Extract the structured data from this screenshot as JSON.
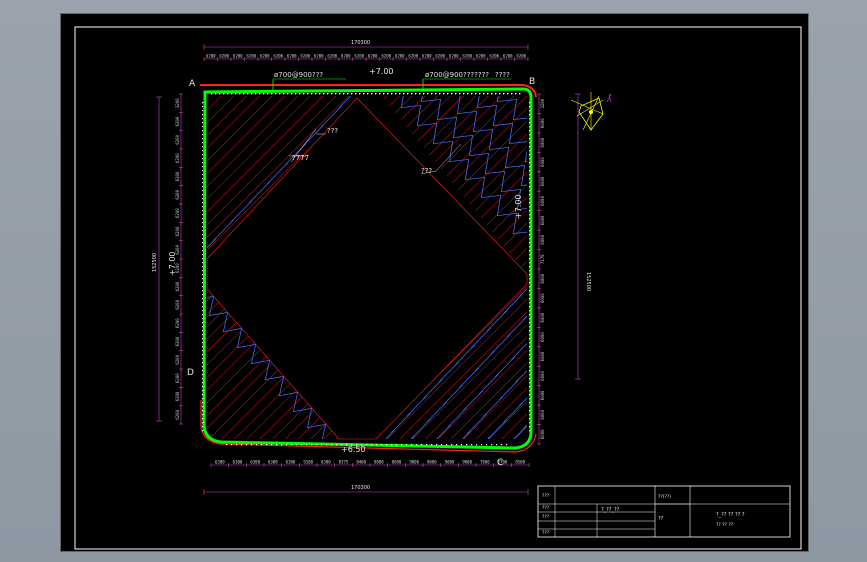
{
  "drawing": {
    "corner_labels": {
      "a": "A",
      "b": "B",
      "c": "C",
      "d": "D"
    },
    "overall_dims": {
      "top": "170300",
      "bottom": "170300",
      "left": "152500",
      "right": "152500"
    },
    "elevations": {
      "top": "+7.00",
      "left": "+7.00",
      "right": "+7.00",
      "bottom": "+6.50"
    },
    "top_callouts": [
      "ø700@900???",
      "ø700@900???????",
      "????"
    ],
    "leaders": [
      "???",
      "?777",
      "???"
    ],
    "top_segments": [
      "6200",
      "6200",
      "6200",
      "6200",
      "6200",
      "6200",
      "6200",
      "6200",
      "6200",
      "6200",
      "6200",
      "6200",
      "6200",
      "6200",
      "6200",
      "6200",
      "6200",
      "6200",
      "6200",
      "6200",
      "6200",
      "6200",
      "6200",
      "6200"
    ],
    "bottom_segments": [
      "6300",
      "6300",
      "6300",
      "6300",
      "6300",
      "9100",
      "6300",
      "8375",
      "8400",
      "8800",
      "8600",
      "9000",
      "9000",
      "9000",
      "9000",
      "7800",
      "2700",
      "8500"
    ],
    "left_segments": [
      "3200",
      "6200",
      "6200",
      "6200",
      "6200",
      "6200",
      "6200",
      "6200",
      "6200",
      "6200",
      "6200",
      "6200",
      "6200",
      "6200",
      "6200",
      "6200",
      "6200",
      "6200"
    ],
    "right_segments": [
      "3200",
      "6000",
      "6000",
      "6000",
      "6000",
      "6000",
      "6000",
      "6000",
      "7170",
      "6000",
      "6000",
      "6000",
      "6000",
      "6000",
      "6000",
      "6000",
      "6000",
      "6000"
    ]
  },
  "title_block": {
    "labels": [
      "???",
      "???",
      "???",
      "???"
    ],
    "project": "?_??_??",
    "sheet_label": "??(??)",
    "sheet_no": "??",
    "drawing_title": "?_?? ?? ?? ?",
    "drawing_scale": "?? ?? ??"
  },
  "colors": {
    "background": "#000000",
    "frame": "#ffffff",
    "wall": "#00ff00",
    "hatch": "#ff2020",
    "truss": "#3a6dff",
    "dimension": "#cc44cc",
    "text": "#ffffff"
  }
}
